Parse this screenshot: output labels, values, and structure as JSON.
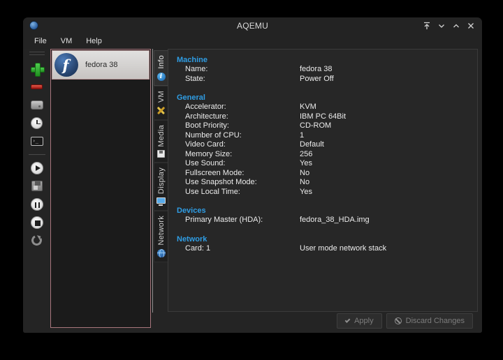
{
  "titlebar": {
    "title": "AQEMU",
    "controls": [
      "keep-above",
      "minimize",
      "maximize",
      "close"
    ]
  },
  "menubar": {
    "items": [
      {
        "label": "File"
      },
      {
        "label": "VM"
      },
      {
        "label": "Help"
      }
    ]
  },
  "toolbar": {
    "buttons": [
      "add-vm",
      "remove-vm",
      "hdd-image-manager",
      "snapshots",
      "emulator-console",
      "start-vm",
      "save-vm",
      "pause-vm",
      "stop-vm",
      "reset-vm"
    ]
  },
  "vm_list": {
    "items": [
      {
        "name": "fedora 38",
        "selected": true,
        "icon": "fedora-logo"
      }
    ]
  },
  "tabs": [
    {
      "label": "Info",
      "icon": "info-icon",
      "selected": true
    },
    {
      "label": "VM",
      "icon": "tools-icon",
      "selected": false
    },
    {
      "label": "Media",
      "icon": "media-icon",
      "selected": false
    },
    {
      "label": "Display",
      "icon": "display-icon",
      "selected": false
    },
    {
      "label": "Network",
      "icon": "network-icon",
      "selected": false
    }
  ],
  "info_pane": {
    "sections": [
      {
        "title": "Machine",
        "rows": [
          {
            "label": "Name:",
            "value": "fedora 38"
          },
          {
            "label": "State:",
            "value": "Power Off"
          }
        ]
      },
      {
        "title": "General",
        "rows": [
          {
            "label": "Accelerator:",
            "value": "KVM"
          },
          {
            "label": "Architecture:",
            "value": "IBM PC 64Bit"
          },
          {
            "label": "Boot Priority:",
            "value": "CD-ROM"
          },
          {
            "label": "Number of CPU:",
            "value": "1"
          },
          {
            "label": "Video Card:",
            "value": "Default"
          },
          {
            "label": "Memory Size:",
            "value": "256"
          },
          {
            "label": "Use Sound:",
            "value": "Yes"
          },
          {
            "label": "Fullscreen Mode:",
            "value": "No"
          },
          {
            "label": "Use Snapshot Mode:",
            "value": "No"
          },
          {
            "label": "Use Local Time:",
            "value": "Yes"
          }
        ]
      },
      {
        "title": "Devices",
        "rows": [
          {
            "label": "Primary Master (HDA):",
            "value": "fedora_38_HDA.img"
          }
        ]
      },
      {
        "title": "Network",
        "rows": [
          {
            "label": "Card: 1",
            "value": "User mode network stack"
          }
        ]
      }
    ]
  },
  "footer": {
    "apply_label": "Apply",
    "discard_label": "Discard Changes"
  },
  "colors": {
    "heading_blue": "#2f9de4",
    "selection_border": "#a8767d",
    "accent_green": "#2fae2f",
    "accent_red": "#c0392b",
    "fedora_navy": "#27446f"
  }
}
